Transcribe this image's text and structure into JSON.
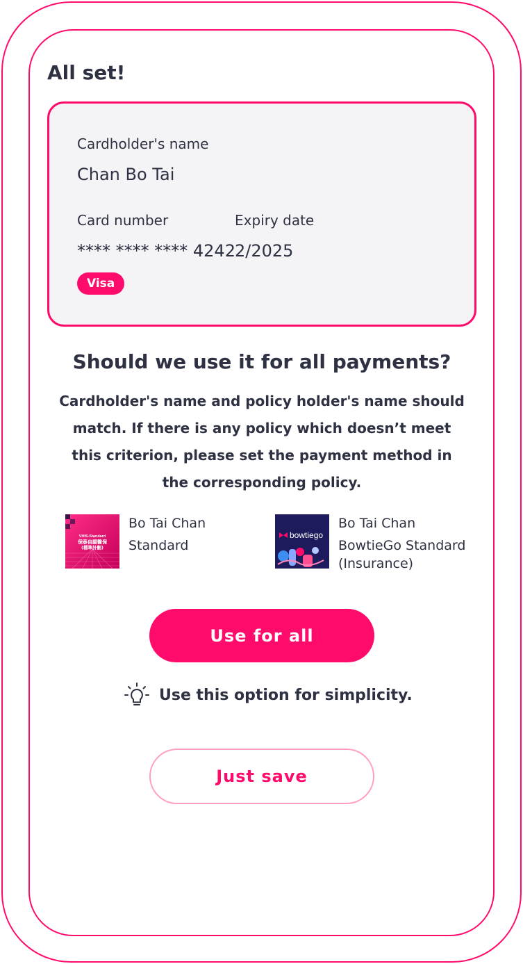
{
  "header": {
    "title": "All set!"
  },
  "card": {
    "holder_label": "Cardholder's name",
    "holder_value": "Chan Bo Tai",
    "number_label": "Card number",
    "number_value": "**** **** **** 4242",
    "expiry_label": "Expiry date",
    "expiry_value": "2/2025",
    "brand_badge": "Visa"
  },
  "prompt": {
    "question": "Should we use it for all payments?",
    "note": "Cardholder's name and policy holder's name should match. If there is any policy which doesn’t meet this criterion, please set the payment method in the corresponding policy."
  },
  "policies": [
    {
      "holder": "Bo Tai Chan",
      "plan": "Standard",
      "thumb_text_1": "VHIS-Standard",
      "thumb_text_2": "保泰自願醫保",
      "thumb_text_3": "(標準計劃)"
    },
    {
      "holder": "Bo Tai Chan",
      "plan": "BowtieGo Standard (Insurance)",
      "thumb_logo": "bowtiego"
    }
  ],
  "actions": {
    "use_for_all": "Use for all",
    "tip": "Use this option for simplicity.",
    "just_save": "Just save"
  },
  "icons": {
    "tip_icon": "lightbulb-icon"
  },
  "colors": {
    "accent": "#ff0b6b",
    "accent_light": "#ff9ec2",
    "text": "#2d3142",
    "card_bg": "#f4f4f6"
  }
}
